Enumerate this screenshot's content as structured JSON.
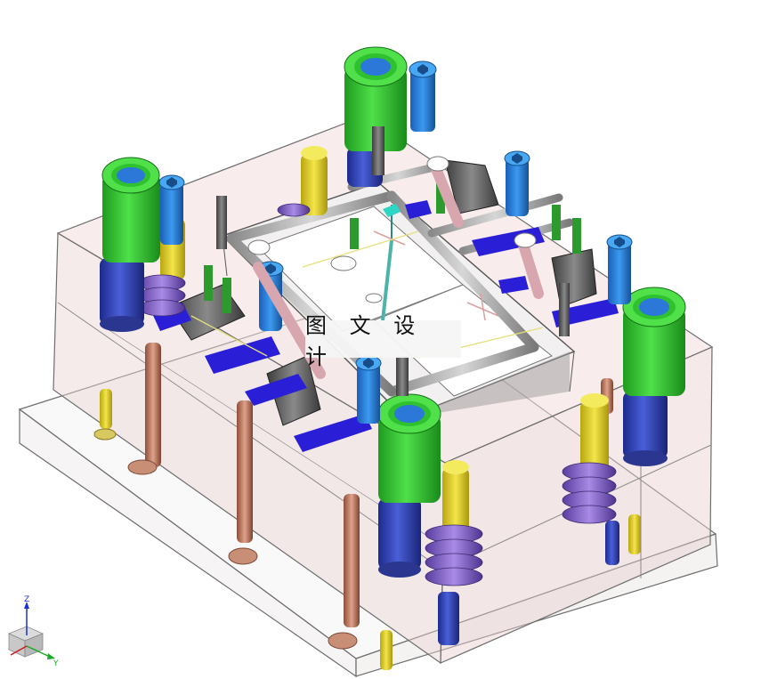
{
  "viewport": {
    "watermark_text": "图 文 设 计",
    "triad": {
      "z_label": "Z",
      "y_label": "Y"
    }
  },
  "colors": {
    "background": "#ffffff",
    "plate_edge": "#6e6e6e",
    "mold_body_tint": "#e8c9c9",
    "guide_bushing_green": "#2fc12f",
    "guide_bushing_blue": "#2b78d8",
    "pillar_blue": "#3346b8",
    "ejector_pin_copper": "#c0785a",
    "support_pin_yellow": "#e3d32a",
    "slider_dark": "#5a5a5a",
    "clamp_blue": "#2a1fd6",
    "cooling_tube_gray": "#b9b9b9",
    "spring_purple": "#8b63d1"
  }
}
